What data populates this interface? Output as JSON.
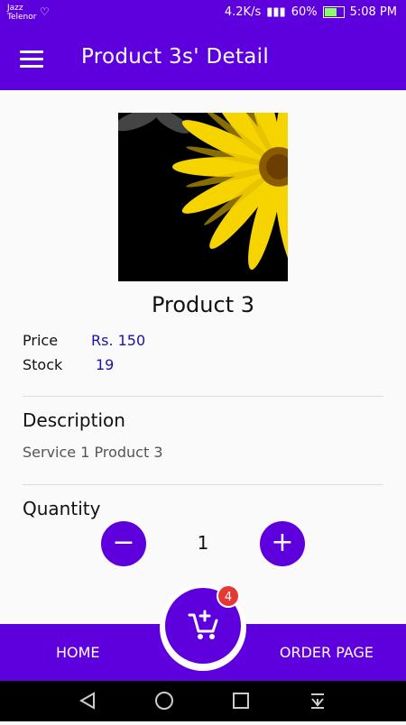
{
  "status_bar": {
    "carrier_line1": "Jazz",
    "carrier_line2": "Telenor",
    "speed": "4.2K/s",
    "battery": "60%",
    "time": "5:08 PM"
  },
  "app_bar": {
    "title": "Product 3s' Detail"
  },
  "product": {
    "name": "Product 3",
    "price_label": "Price",
    "price_value": "Rs. 150",
    "stock_label": "Stock",
    "stock_value": "19"
  },
  "description": {
    "title": "Description",
    "text": "Service 1 Product 3"
  },
  "quantity": {
    "title": "Quantity",
    "value": "1",
    "minus": "−",
    "plus": "+"
  },
  "bottom_nav": {
    "home": "HOME",
    "order_page": "ORDER PAGE",
    "cart_badge": "4"
  },
  "colors": {
    "primary": "#5e00dd",
    "badge": "#e53935",
    "value_text": "#1a12a8"
  }
}
